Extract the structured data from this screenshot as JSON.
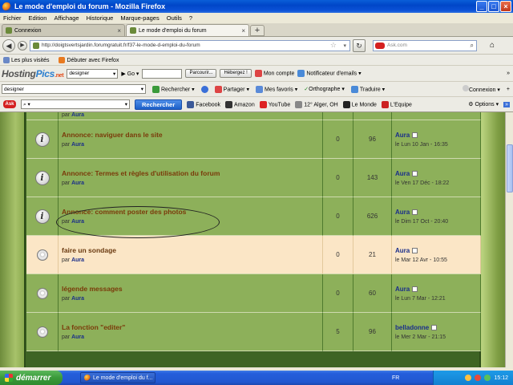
{
  "window": {
    "title": "Le mode d'emploi du forum - Mozilla Firefox"
  },
  "menu": [
    "Fichier",
    "Edition",
    "Affichage",
    "Historique",
    "Marque-pages",
    "Outils",
    "?"
  ],
  "tabs": [
    {
      "label": "Connexion"
    },
    {
      "label": "Le mode d'emploi du forum"
    }
  ],
  "nav": {
    "url": "http://doigtsvertsjardin.forumgratuit.fr/f37-le-mode-d-emploi-du-forum",
    "search_placeholder": "Ask.com"
  },
  "bookmarks": [
    "Les plus visités",
    "Débuter avec Firefox"
  ],
  "hostingpics": {
    "logo_hosting": "Hosting",
    "logo_pics": "Pics",
    "logo_net": ".net",
    "select_value": "designer",
    "go": "Go",
    "browse": "Parcourir...",
    "host": "Hébergez !",
    "account": "Mon compte",
    "notifier": "Notificateur d'emails"
  },
  "toolbar2": {
    "select_value": "designer",
    "search": "Rechercher",
    "share": "Partager",
    "favorites": "Mes favoris",
    "spelling": "Orthographe",
    "translate": "Traduire",
    "login": "Connexion"
  },
  "toolbar3": {
    "search_btn": "Rechercher",
    "links": [
      "Facebook",
      "Amazon",
      "YouTube",
      "12° Alger, OH",
      "Le Monde",
      "L'Equipe"
    ],
    "options": "Options"
  },
  "forum": {
    "partial_by": "par",
    "partial_author": "Aura",
    "by_label": "par",
    "topics": [
      {
        "type": "announce",
        "style": "green",
        "title": "Annonce: naviguer dans le site",
        "author": "Aura",
        "replies": "0",
        "views": "96",
        "last_author": "Aura",
        "last_date": "le Lun 10 Jan - 16:35"
      },
      {
        "type": "announce",
        "style": "green",
        "title": "Annonce: Termes et règles d'utilisation du forum",
        "author": "Aura",
        "replies": "0",
        "views": "143",
        "last_author": "Aura",
        "last_date": "le Ven 17 Déc - 18:22"
      },
      {
        "type": "announce",
        "style": "green",
        "title": "Annonce: comment poster des photos",
        "author": "Aura",
        "replies": "0",
        "views": "626",
        "last_author": "Aura",
        "last_date": "le Dim 17 Oct - 20:40"
      },
      {
        "type": "topic",
        "style": "peach",
        "title": "faire un sondage",
        "author": "Aura",
        "replies": "0",
        "views": "21",
        "last_author": "Aura",
        "last_date": "le Mar 12 Avr - 10:55"
      },
      {
        "type": "topic",
        "style": "green",
        "title": "légende messages",
        "author": "Aura",
        "replies": "0",
        "views": "60",
        "last_author": "Aura",
        "last_date": "le Lun 7 Mar - 12:21"
      },
      {
        "type": "topic",
        "style": "green",
        "title": "La fonction \"editer\"",
        "author": "Aura",
        "replies": "5",
        "views": "96",
        "last_author": "belladonne",
        "last_date": "le Mer 2 Mar - 21:15"
      }
    ]
  },
  "taskbar": {
    "start": "démarrer",
    "task": "Le mode d'emploi du f...",
    "lang": "FR",
    "clock": "15:12"
  },
  "colors": {
    "forum_green": "#8db05a",
    "forum_peach": "#fbe6c6",
    "titlebar_blue": "#0046c8"
  }
}
